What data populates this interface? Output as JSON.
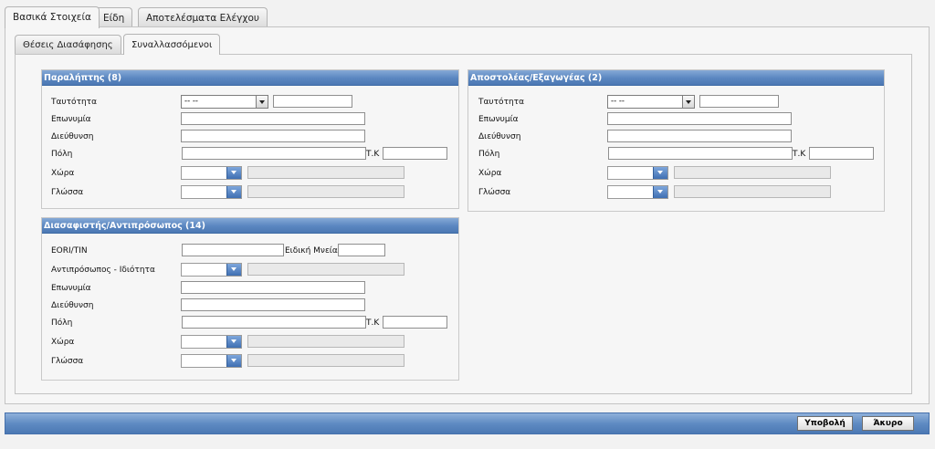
{
  "main_tabs": [
    "Βασικά Στοιχεία",
    "Είδη",
    "Αποτελέσματα Ελέγχου"
  ],
  "sub_tabs": [
    "Θέσεις Διασάφησης",
    "Συναλλασσόμενοι"
  ],
  "consignee": {
    "title": "Παραλήπτης (8)",
    "id_label": "Ταυτότητα",
    "id_type_value": "-- --",
    "name_label": "Επωνυμία",
    "address_label": "Διεύθυνση",
    "city_label": "Πόλη",
    "postcode_label": "Τ.Κ",
    "country_label": "Χώρα",
    "language_label": "Γλώσσα"
  },
  "consignor": {
    "title": "Αποστολέας/Εξαγωγέας (2)",
    "id_label": "Ταυτότητα",
    "id_type_value": "-- --",
    "name_label": "Επωνυμία",
    "address_label": "Διεύθυνση",
    "city_label": "Πόλη",
    "postcode_label": "Τ.Κ",
    "country_label": "Χώρα",
    "language_label": "Γλώσσα"
  },
  "declarant": {
    "title": "Διασαφιστής/Αντιπρόσωπος (14)",
    "eori_label": "EORI/TIN",
    "special_mention_label": "Ειδική Μνεία",
    "representative_label": "Αντιπρόσωπος - Ιδιότητα",
    "name_label": "Επωνυμία",
    "address_label": "Διεύθυνση",
    "city_label": "Πόλη",
    "postcode_label": "Τ.Κ",
    "country_label": "Χώρα",
    "language_label": "Γλώσσα"
  },
  "footer": {
    "submit_label": "Υποβολή",
    "cancel_label": "Άκυρο"
  },
  "colors": {
    "header_blue": "#5a86c0",
    "panel_bg": "#f6f6f6"
  }
}
